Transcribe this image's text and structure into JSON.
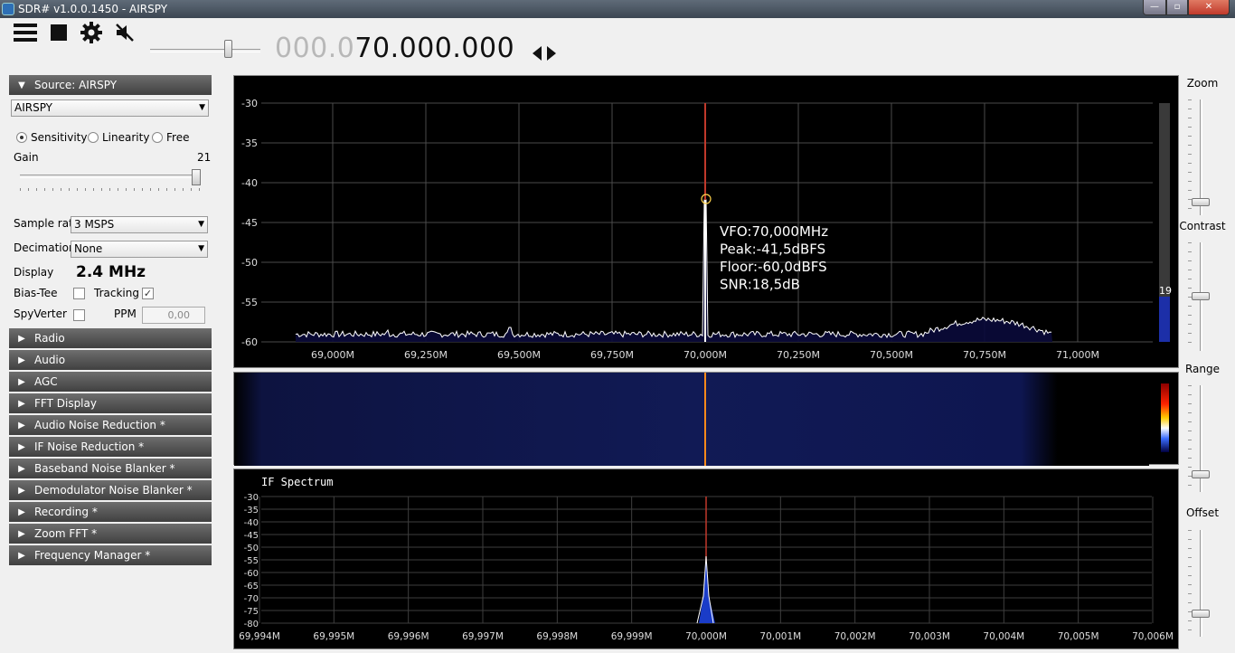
{
  "window": {
    "title": "SDR# v1.0.0.1450 - AIRSPY",
    "min_glyph": "—",
    "max_glyph": "▫",
    "close_glyph": "✕"
  },
  "toolbar": {
    "freq_dim": "000.0",
    "freq_bright": "70.000.000"
  },
  "source": {
    "header": "Source: AIRSPY",
    "device": "AIRSPY",
    "modes": [
      "Sensitivity",
      "Linearity",
      "Free"
    ],
    "selected_mode": "Sensitivity",
    "gain_label": "Gain",
    "gain_value": "21",
    "sample_rate_label": "Sample rate",
    "sample_rate": "3 MSPS",
    "decimation_label": "Decimation",
    "decimation": "None",
    "display_label": "Display",
    "display_value": "2.4 MHz",
    "bias_tee_label": "Bias-Tee",
    "tracking_label": "Tracking",
    "tracking_checked": true,
    "spyverter_label": "SpyVerter",
    "ppm_label": "PPM",
    "ppm_value": "0,00"
  },
  "sections": [
    "Radio",
    "Audio",
    "AGC",
    "FFT Display",
    "Audio Noise Reduction *",
    "IF Noise Reduction *",
    "Baseband Noise Blanker *",
    "Demodulator Noise Blanker *",
    "Recording *",
    "Zoom FFT *",
    "Frequency Manager *"
  ],
  "right_sliders": {
    "labels": [
      "Zoom",
      "Contrast",
      "Range",
      "Offset"
    ]
  },
  "spectrum": {
    "y_ticks": [
      "-30",
      "-35",
      "-40",
      "-45",
      "-50",
      "-55",
      "-60"
    ],
    "x_ticks": [
      "69,000M",
      "69,250M",
      "69,500M",
      "69,750M",
      "70,000M",
      "70,250M",
      "70,500M",
      "70,750M",
      "71,000M"
    ],
    "vfo": "VFO:70,000MHz",
    "peak": "Peak:-41,5dBFS",
    "floor": "Floor:-60,0dBFS",
    "snr": "SNR:18,5dB",
    "meter_value": "19",
    "colors": {
      "trace": "#ffffff",
      "vfo_line": "#c0392b",
      "grid": "#4a4a4a"
    }
  },
  "if_spectrum": {
    "title": "IF Spectrum",
    "y_ticks": [
      "-30",
      "-35",
      "-40",
      "-45",
      "-50",
      "-55",
      "-60",
      "-65",
      "-70",
      "-75",
      "-80"
    ],
    "x_ticks": [
      "69,994M",
      "69,995M",
      "69,996M",
      "69,997M",
      "69,998M",
      "69,999M",
      "70,000M",
      "70,001M",
      "70,002M",
      "70,003M",
      "70,004M",
      "70,005M",
      "70,006M"
    ]
  }
}
